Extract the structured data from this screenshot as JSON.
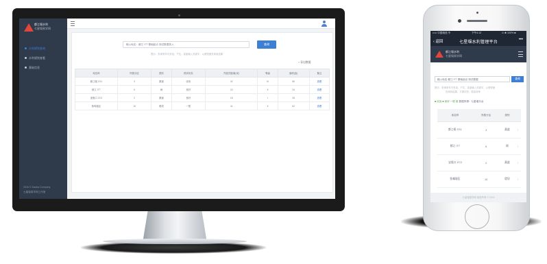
{
  "desktop": {
    "brand": {
      "line1": "都江堰水利",
      "line2": "七星堰易学网"
    },
    "nav": [
      {
        "label": "水利规划查询"
      },
      {
        "label": "水利规划查看"
      },
      {
        "label": "基础信息"
      }
    ],
    "footer": {
      "line1": "2016 © Dasha Company",
      "line2": "七星堰易学网工作室"
    },
    "search": {
      "value": "输入地名：都江 ITT 基础起点 测试数据录入",
      "button": "查询"
    },
    "hint": "提示：查询条件可多选，下拉，或者输入关键字，以便快速查询到结果",
    "export_label": "> 导出数据",
    "table": {
      "headers": [
        "地名称",
        "所属分区",
        "类别",
        "现状状态",
        "所处的距离(米)",
        "等级",
        "面积(亩)",
        "备注"
      ],
      "rows": [
        [
          "都江堰 ZG1",
          "3",
          "渠道",
          "优良",
          "32",
          "III",
          "56",
          "查看"
        ],
        [
          "都江 ITT",
          "6",
          "闸",
          "良好",
          "24",
          "II",
          "34",
          "查看"
        ],
        [
          "宝瓶口 ZC3",
          "2",
          "渠道",
          "良好",
          "18",
          "I",
          "28",
          "查看"
        ],
        [
          "鱼嘴堰区",
          "10",
          "堤坝",
          "一般",
          "41",
          "II",
          "62",
          "查看"
        ]
      ]
    }
  },
  "phone": {
    "status": {
      "carrier": "••••• 中国电信 令",
      "time": "下午4:13",
      "battery": "⊙ ✱ 100% ■"
    },
    "nav": {
      "back": "‹ 返回",
      "title": "七星堰水利管理平台",
      "more": "•••"
    },
    "brand": {
      "line1": "都江堰水利",
      "line2": "七星堰易学网"
    },
    "search": {
      "value": "输入地名 都江 ITT 基础起点 测试数据",
      "button": "查询"
    },
    "hint1": "提示：查询条件可多选，下拉，或者输入关键字，以便快速",
    "hint2": "查询到结果，方便浏览，提高效率",
    "legend": {
      "a": "■ 优良",
      "b": "■ 良好 一般 差",
      "c": "数据来源：七星堰平台"
    },
    "table": {
      "headers": [
        "地名称",
        "所属分区",
        "类别"
      ],
      "rows": [
        [
          "都江堰 ZG1",
          "3",
          "渠道"
        ],
        [
          "都江 ITT",
          "6",
          "闸"
        ],
        [
          "宝瓶口 ZC3",
          "2",
          "渠道"
        ],
        [
          "鱼嘴堰区",
          "10",
          "堤坝"
        ]
      ]
    },
    "footer": "七星堰易学网 版权所有 © 2016"
  }
}
